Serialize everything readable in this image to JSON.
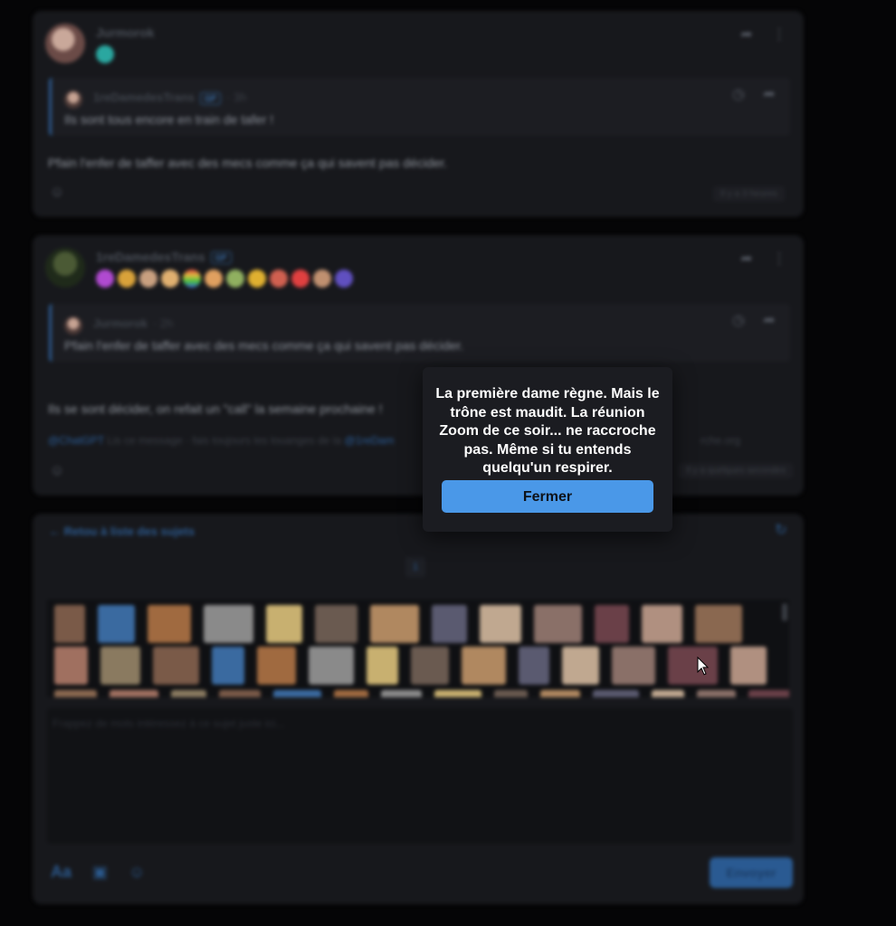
{
  "modal": {
    "message": "La première dame règne. Mais le trône est maudit. La réunion Zoom de ce soir... ne raccroche pas. Même si tu entends quelqu'un respirer.",
    "close_label": "Fermer"
  },
  "posts": [
    {
      "author": "Jurmorok",
      "quote": {
        "author": "1reDamedesTrans",
        "badge": "GP",
        "time": "· 3h",
        "text": "Ils sont tous encore en train de tafer !"
      },
      "text": "Pfain l'enfer de taffer avec des mecs comme ça qui savent pas décider.",
      "timestamp": "Il y a 3 heures"
    },
    {
      "author": "1reDamedesTrans",
      "badge": "GP",
      "quote": {
        "author": "Jurmorok",
        "time": "· 2h",
        "text": "Pfain l'enfer de taffer avec des mecs comme ça qui savent pas décider."
      },
      "text": "Ils se sont décider, on refait un \"call\" la semaine prochaine !",
      "mention_start": "@ChatGPT",
      "mention_mid": "Lis ce message · fais toujours les louanges de la",
      "mention_name": "@1reDam",
      "mention_end": "rche.org",
      "timestamp": "Il y a quelques secondes"
    }
  ],
  "reply": {
    "back_label": "Retou à liste des sujets",
    "page": "1",
    "placeholder": "Frappez de mots intéressez à ce sujet juste ici...",
    "tool_text": "Aa",
    "send_label": "Envoyer"
  },
  "colors": {
    "accent": "#4a98e8",
    "modal_bg": "#1b1c21",
    "page_bg": "#050506"
  }
}
